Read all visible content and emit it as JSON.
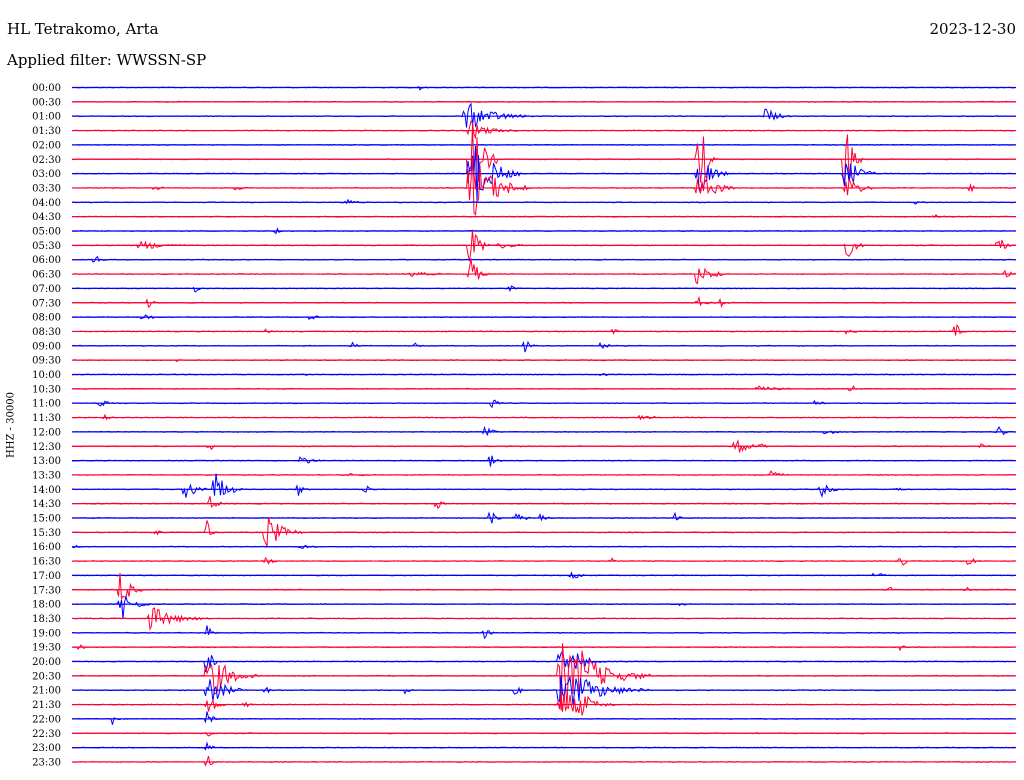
{
  "header": {
    "station": "HL Tetrakomo, Arta",
    "filter": "Applied filter: WWSSN-SP",
    "date": "2023-12-30"
  },
  "chart_data": {
    "type": "line",
    "title": "HL Tetrakomo, Arta",
    "subtitle": "Applied filter: WWSSN-SP",
    "ylabel": "HHZ - 30000",
    "xlabel": "",
    "row_labels": [
      "00:00",
      "00:30",
      "01:00",
      "01:30",
      "02:00",
      "02:30",
      "03:00",
      "03:30",
      "04:00",
      "04:30",
      "05:00",
      "05:30",
      "06:00",
      "06:30",
      "07:00",
      "07:30",
      "08:00",
      "08:30",
      "09:00",
      "09:30",
      "10:00",
      "10:30",
      "11:00",
      "11:30",
      "12:00",
      "12:30",
      "13:00",
      "13:30",
      "14:00",
      "14:30",
      "15:00",
      "15:30",
      "16:00",
      "16:30",
      "17:00",
      "17:30",
      "18:00",
      "18:30",
      "19:00",
      "19:30",
      "20:00",
      "20:30",
      "21:00",
      "21:30",
      "22:00",
      "22:30",
      "23:00",
      "23:30"
    ],
    "colors": {
      "even": "#0000ff",
      "odd": "#ff0033"
    },
    "grid": false,
    "legend": "none"
  }
}
